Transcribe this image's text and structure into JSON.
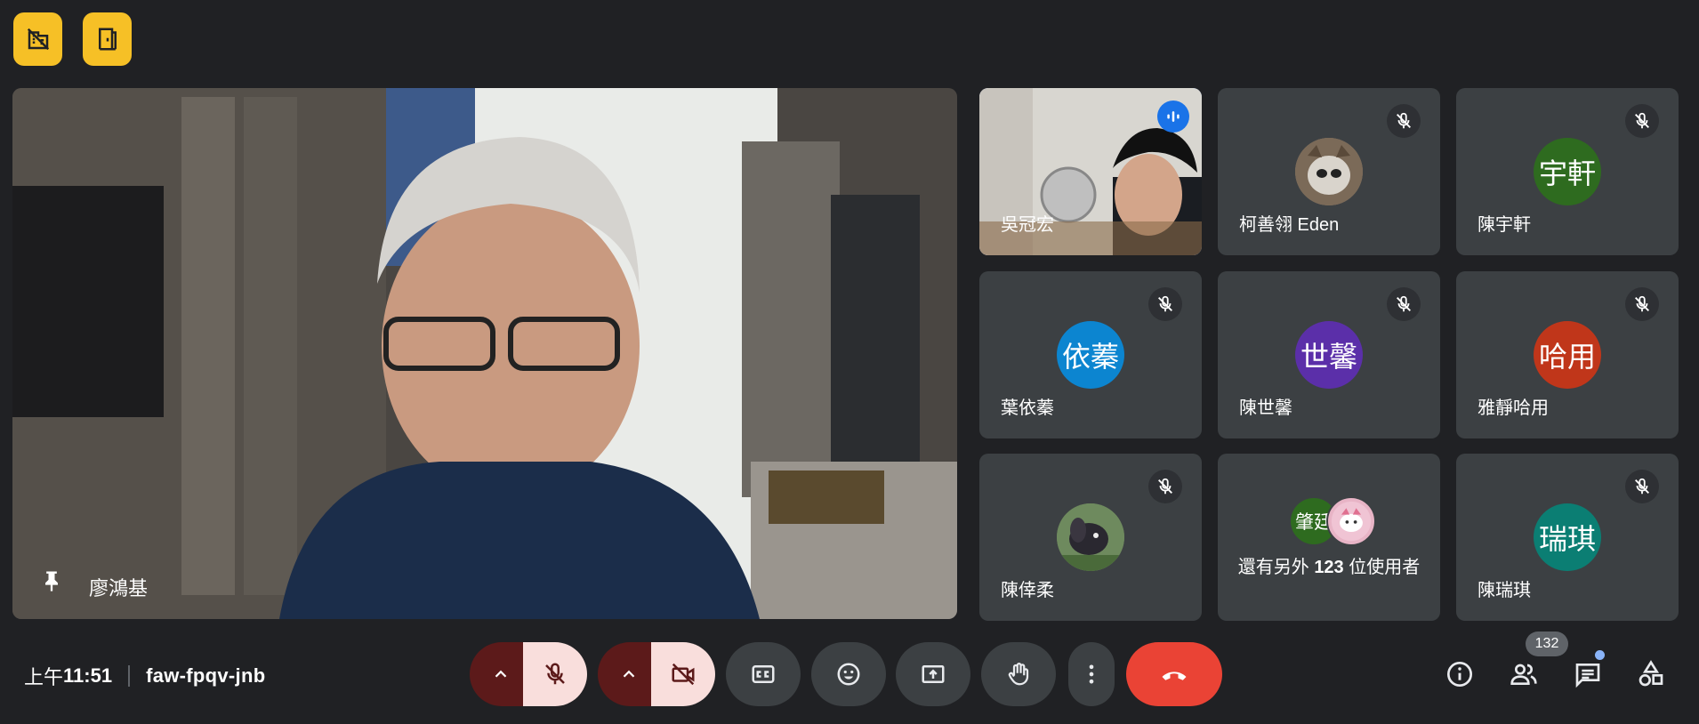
{
  "top_buttons": [
    {
      "icon": "no-building-icon"
    },
    {
      "icon": "door-icon"
    }
  ],
  "main_tile": {
    "name": "廖鴻基",
    "pin_icon": "pin-icon"
  },
  "participants": [
    {
      "name": "吳冠宏",
      "type": "video",
      "speaking": true
    },
    {
      "name": "柯善翎 Eden",
      "type": "photo",
      "muted": true
    },
    {
      "name": "陳宇軒",
      "avatar_text": "宇軒",
      "avatar_color": "#2e6b1f",
      "muted": true
    },
    {
      "name": "葉依蓁",
      "avatar_text": "依蓁",
      "avatar_color": "#0c85d0",
      "muted": true
    },
    {
      "name": "陳世馨",
      "avatar_text": "世馨",
      "avatar_color": "#5b2fa9",
      "muted": true
    },
    {
      "name": "雅靜哈用",
      "avatar_text": "哈用",
      "avatar_color": "#c0361a",
      "muted": true
    },
    {
      "name": "陳倖柔",
      "type": "photo",
      "muted": true
    },
    {
      "name": "陳瑞琪",
      "avatar_text": "瑞琪",
      "avatar_color": "#0b7e73",
      "muted": true
    }
  ],
  "more_tile": {
    "prefix": "還有另外 ",
    "count": "123",
    "suffix": " 位使用者",
    "mini_avatar_text": "肇廷",
    "mini_avatar_color": "#2e6b1f"
  },
  "meeting": {
    "time_prefix": "上午",
    "time": "11:51",
    "code": "faw-fpqv-jnb"
  },
  "controls": {
    "mic": "mic-off-icon",
    "camera": "camera-off-icon",
    "captions": "captions-icon",
    "emoji": "emoji-icon",
    "present": "present-icon",
    "raise_hand": "hand-icon",
    "more": "more-vert-icon",
    "leave": "call-end-icon"
  },
  "right_panel": {
    "people_count": "132"
  },
  "colors": {
    "background": "#202124",
    "tile": "#3c4043",
    "accent": "#8ab4f8",
    "leave": "#ea4335",
    "top_button": "#f6c026"
  }
}
